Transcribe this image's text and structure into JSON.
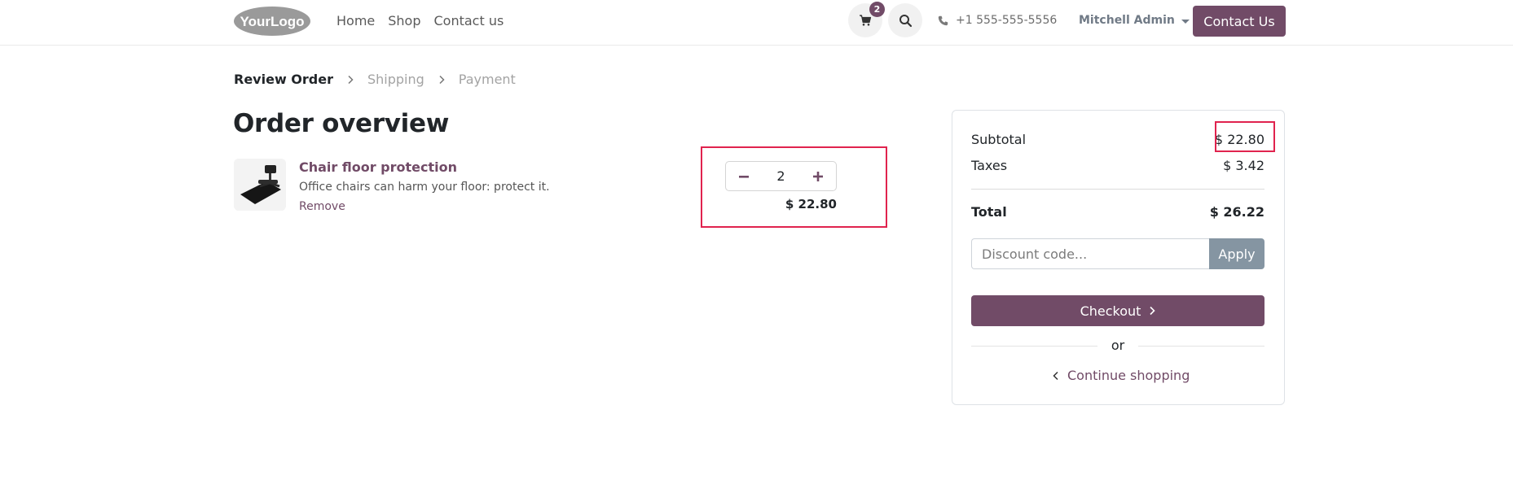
{
  "header": {
    "logo_text": "YourLogo",
    "nav": [
      "Home",
      "Shop",
      "Contact us"
    ],
    "cart_count": "2",
    "phone": "+1 555-555-5556",
    "user": "Mitchell Admin",
    "contact_button": "Contact Us"
  },
  "breadcrumb": {
    "steps": [
      "Review Order",
      "Shipping",
      "Payment"
    ]
  },
  "page_title": "Order overview",
  "line_item": {
    "name": "Chair floor protection",
    "description": "Office chairs can harm your floor: protect it.",
    "remove": "Remove",
    "quantity": "2",
    "price": "$ 22.80"
  },
  "summary": {
    "subtotal_label": "Subtotal",
    "subtotal_value": "$ 22.80",
    "taxes_label": "Taxes",
    "taxes_value": "$ 3.42",
    "total_label": "Total",
    "total_value": "$ 26.22",
    "discount_placeholder": "Discount code...",
    "apply_label": "Apply",
    "checkout_label": "Checkout",
    "or_label": "or",
    "continue_label": "Continue shopping"
  },
  "colors": {
    "brand": "#714b67",
    "highlight": "#e0234e",
    "apply_button": "#8595a2"
  }
}
